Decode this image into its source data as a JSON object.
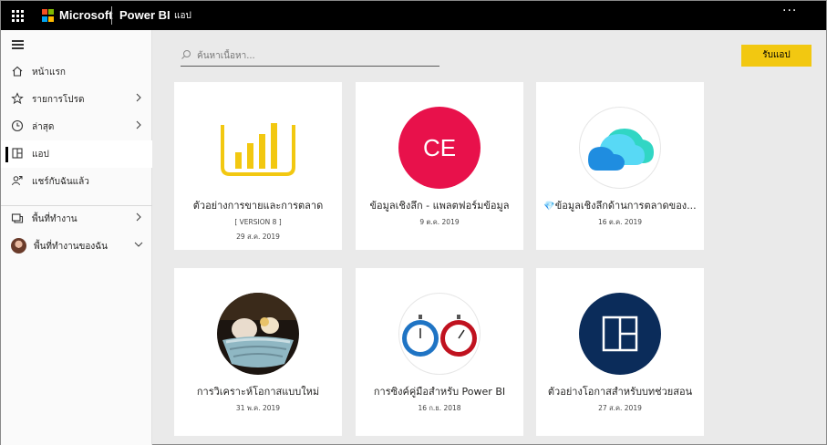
{
  "topbar": {
    "brand": "Microsoft",
    "product": "Power BI",
    "breadcrumb": "แอป",
    "more": "···"
  },
  "sidebar": {
    "items": [
      {
        "label": "หน้าแรก",
        "icon": "home-icon"
      },
      {
        "label": "รายการโปรด",
        "icon": "star-icon"
      },
      {
        "label": "ล่าสุด",
        "icon": "clock-icon"
      },
      {
        "label": "แอป",
        "icon": "apps-icon"
      },
      {
        "label": "แชร์กับฉันแล้ว",
        "icon": "shared-icon"
      },
      {
        "label": "พื้นที่ทำงาน",
        "icon": "workspaces-icon"
      },
      {
        "label": "พื้นที่ทำงานของฉัน",
        "icon": "avatar"
      }
    ]
  },
  "search": {
    "placeholder": "ค้นหาเนื้อหา..."
  },
  "get_apps_label": "รับแอป",
  "cards": [
    {
      "title": "ตัวอย่างการขายและการตลาด",
      "version": "[ VERSION 8 ]",
      "date": "29 ส.ค. 2019"
    },
    {
      "title": "ข้อมูลเชิงลึก - แพลตฟอร์มข้อมูล",
      "logo_text": "CE",
      "date": "9 ต.ค. 2019"
    },
    {
      "title": "ข้อมูลเชิงลึกด้านการตลาดของ...",
      "prefix_icon": "diamond-icon",
      "date": "16 ต.ค. 2019"
    },
    {
      "title": "การวิเคราะห์โอกาสแบบใหม่",
      "date": "31 พ.ค. 2019"
    },
    {
      "title": "การซิงค์คู่มือสำหรับ Power BI",
      "date": "16 ก.ย. 2018"
    },
    {
      "title": "ตัวอย่างโอกาสสำหรับบทช่วยสอน",
      "date": "27 ส.ค. 2019"
    }
  ],
  "colors": {
    "accent": "#f2c811",
    "ce_logo": "#e8114b",
    "navy_logo": "#0b2c5a"
  }
}
